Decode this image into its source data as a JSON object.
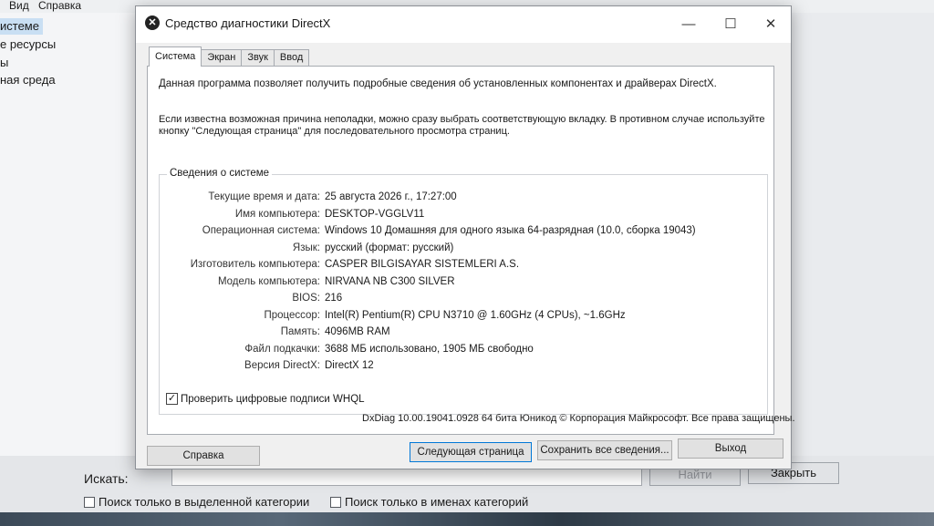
{
  "background_window": {
    "menu": [
      "Вид",
      "Справка"
    ],
    "tree_items": [
      "истеме",
      "е ресурсы",
      "ы",
      "ная среда"
    ],
    "find_label": "Искать:",
    "find_button": "Найти",
    "close_button": "Закрыть",
    "checkbox_selected_category": "Поиск только в выделенной категории",
    "checkbox_category_names": "Поиск только в именах категорий"
  },
  "dxdiag": {
    "title": "Средство диагностики DirectX",
    "controls": {
      "minimize": "—",
      "maximize": "☐",
      "close": "✕"
    },
    "tabs": [
      "Система",
      "Экран",
      "Звук",
      "Ввод"
    ],
    "active_tab": "Система",
    "intro_1": "Данная программа позволяет получить подробные сведения об установленных компонентах и драйверах DirectX.",
    "intro_2": "Если известна возможная причина неполадки, можно сразу выбрать соответствующую вкладку. В противном случае используйте кнопку \"Следующая страница\" для последовательного просмотра страниц.",
    "group_title": "Сведения о системе",
    "info": [
      {
        "label": "Текущие время и дата:",
        "value": "25 августа 2026 г., 17:27:00"
      },
      {
        "label": "Имя компьютера:",
        "value": "DESKTOP-VGGLV11"
      },
      {
        "label": "Операционная система:",
        "value": "Windows 10 Домашняя для одного языка 64-разрядная (10.0, сборка 19043)"
      },
      {
        "label": "Язык:",
        "value": "русский (формат: русский)"
      },
      {
        "label": "Изготовитель компьютера:",
        "value": "CASPER BILGISAYAR SISTEMLERI A.S."
      },
      {
        "label": "Модель компьютера:",
        "value": "NIRVANA NB C300 SILVER"
      },
      {
        "label": "BIOS:",
        "value": "216"
      },
      {
        "label": "Процессор:",
        "value": "Intel(R) Pentium(R) CPU  N3710  @ 1.60GHz (4 CPUs), ~1.6GHz"
      },
      {
        "label": "Память:",
        "value": "4096MB RAM"
      },
      {
        "label": "Файл подкачки:",
        "value": "3688 МБ использовано, 1905 МБ свободно"
      },
      {
        "label": "Версия DirectX:",
        "value": "DirectX 12"
      }
    ],
    "whql_checkbox": "Проверить цифровые подписи WHQL",
    "whql_mark": "✓",
    "footer": "DxDiag 10.00.19041.0928 64 бита Юникод © Корпорация Майкрософт. Все права защищены.",
    "buttons": {
      "help": "Справка",
      "next_page": "Следующая страница",
      "save_all": "Сохранить все сведения...",
      "exit": "Выход"
    }
  }
}
